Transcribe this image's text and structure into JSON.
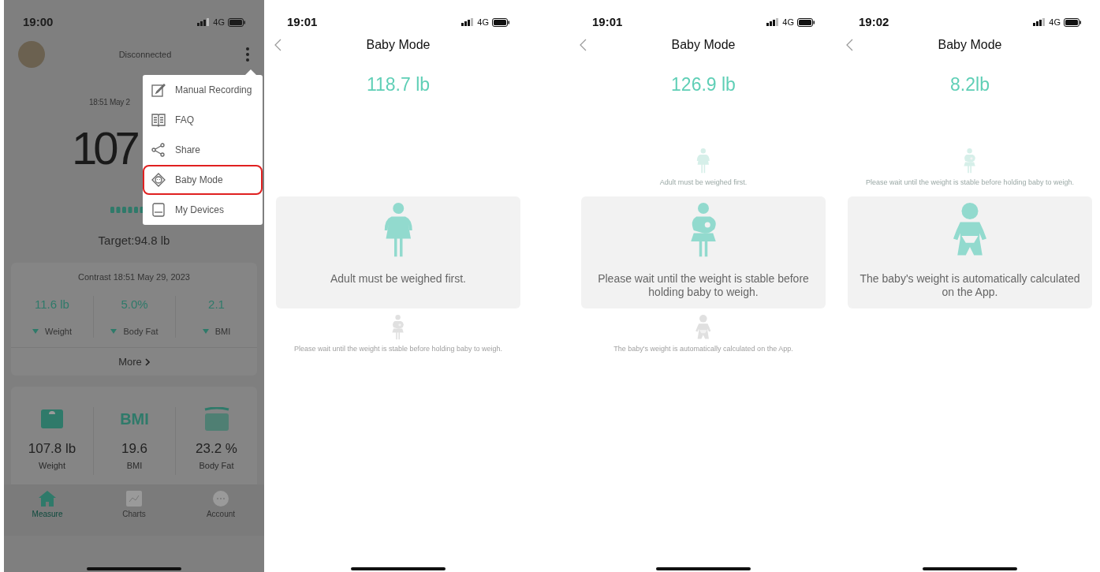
{
  "home": {
    "status_bar": {
      "time": "19:00",
      "network": "4G"
    },
    "connection": "Disconnected",
    "measurement": {
      "date": "18:51 May 2",
      "weight": "107",
      "target": "Target:94.8 lb"
    },
    "contrast": {
      "title": "Contrast 18:51 May 29, 2023",
      "more": "More",
      "items": [
        {
          "value": "11.6 lb",
          "label": "Weight",
          "decreased": true
        },
        {
          "value": "5.0%",
          "label": "Body Fat",
          "decreased": true
        },
        {
          "value": "2.1",
          "label": "BMI",
          "decreased": true
        }
      ]
    },
    "summary": [
      {
        "kind": "scale",
        "value": "107.8 lb",
        "label": "Weight"
      },
      {
        "kind": "text",
        "icon_text": "BMI",
        "value": "19.6",
        "label": "BMI"
      },
      {
        "kind": "body",
        "value": "23.2 %",
        "label": "Body Fat"
      }
    ],
    "tabs": [
      {
        "kind": "home",
        "label": "Measure",
        "selected": true
      },
      {
        "kind": "chart",
        "label": "Charts",
        "selected": false
      },
      {
        "kind": "more",
        "label": "Account",
        "selected": false
      }
    ],
    "menu": {
      "items": [
        {
          "kind": "edit",
          "label": "Manual Recording",
          "highlighted": false
        },
        {
          "kind": "book",
          "label": "FAQ",
          "highlighted": false
        },
        {
          "kind": "share",
          "label": "Share",
          "highlighted": false
        },
        {
          "kind": "baby",
          "label": "Baby Mode",
          "highlighted": true
        },
        {
          "kind": "device",
          "label": "My Devices",
          "highlighted": false
        }
      ]
    }
  },
  "baby_screens": [
    {
      "status_bar": {
        "time": "19:01",
        "network": "4G"
      },
      "title": "Baby Mode",
      "weight": "118.7 lb",
      "steps": [
        {
          "kind": "adult",
          "current": true,
          "text": "Adult must be weighed first."
        },
        {
          "kind": "holding",
          "current": false,
          "done": false,
          "text": "Please wait until the weight is stable before holding baby to weigh."
        }
      ]
    },
    {
      "status_bar": {
        "time": "19:01",
        "network": "4G"
      },
      "title": "Baby Mode",
      "weight": "126.9 lb",
      "steps": [
        {
          "kind": "adult",
          "current": false,
          "done": true,
          "text": "Adult must be weighed first."
        },
        {
          "kind": "holding",
          "current": true,
          "text": "Please wait until the weight is stable before holding baby to weigh."
        },
        {
          "kind": "baby",
          "current": false,
          "done": false,
          "text": "The baby's weight is automatically calculated on the App."
        }
      ]
    },
    {
      "status_bar": {
        "time": "19:02",
        "network": "4G"
      },
      "title": "Baby Mode",
      "weight": "8.2lb",
      "steps": [
        {
          "kind": "holding",
          "current": false,
          "done": true,
          "text": "Please wait until the weight is stable before holding baby to weigh."
        },
        {
          "kind": "baby",
          "current": true,
          "text": "The baby's weight is automatically calculated on the App."
        }
      ]
    }
  ]
}
